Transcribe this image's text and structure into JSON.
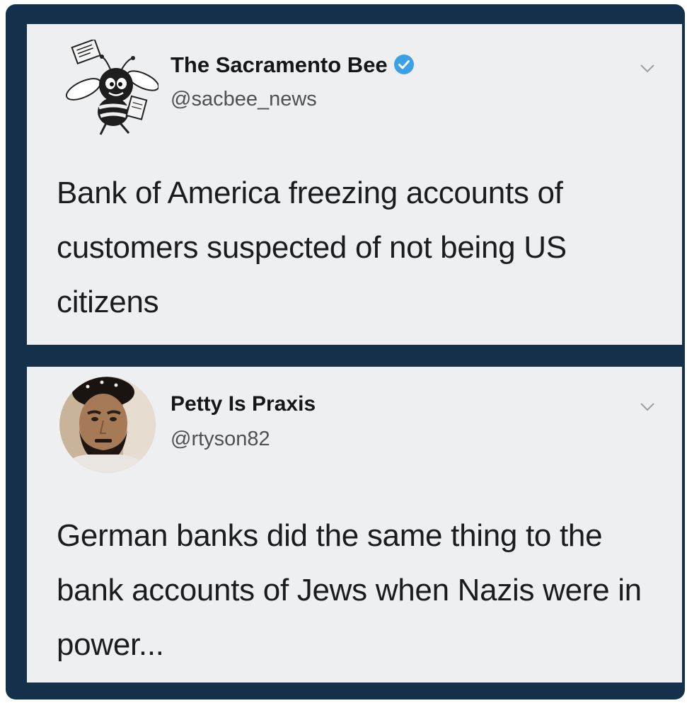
{
  "tweets": [
    {
      "display_name": "The Sacramento Bee",
      "handle": "@sacbee_news",
      "verified": true,
      "avatar_icon": "bee-mascot-icon",
      "text": "Bank of America freezing accounts of customers suspected of not being US citizens"
    },
    {
      "display_name": "Petty Is Praxis",
      "handle": "@rtyson82",
      "verified": false,
      "avatar_icon": "user-photo-avatar",
      "text": "German banks did the same thing to the bank accounts of Jews when Nazis were in power..."
    }
  ],
  "colors": {
    "frame": "#15304a",
    "card": "#eeeff1",
    "verified_badge": "#3aa0e8",
    "text": "#1b1c1e"
  }
}
